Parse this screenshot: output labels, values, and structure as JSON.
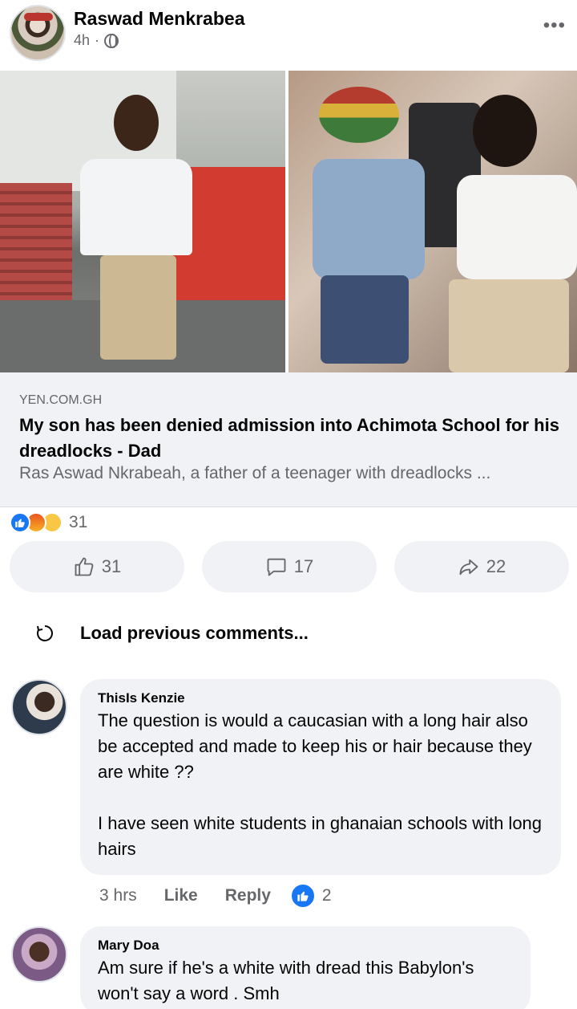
{
  "post": {
    "author": "Raswad Menkrabea",
    "time": "4h",
    "separator": "·"
  },
  "link": {
    "domain": "YEN.COM.GH",
    "title": "My son has been denied admission into Achimota School for his dreadlocks - Dad",
    "description": "Ras Aswad Nkrabeah, a father of a teenager with dreadlocks ..."
  },
  "reactions": {
    "count": "31"
  },
  "actions": {
    "like_count": "31",
    "comment_count": "17",
    "share_count": "22"
  },
  "comments_section": {
    "load_previous": "Load previous comments..."
  },
  "comments": [
    {
      "name": "ThisIs Kenzie",
      "text": "The question is would a caucasian with a long hair also be accepted and made to keep his or hair because they are white ??\n\nI have seen white students in ghanaian schools with long hairs",
      "time": "3 hrs",
      "like_label": "Like",
      "reply_label": "Reply",
      "reaction_count": "2"
    },
    {
      "name": "Mary Doa",
      "text": "Am sure if he's a white with dread this Babylon's won't say a word . Smh"
    }
  ]
}
